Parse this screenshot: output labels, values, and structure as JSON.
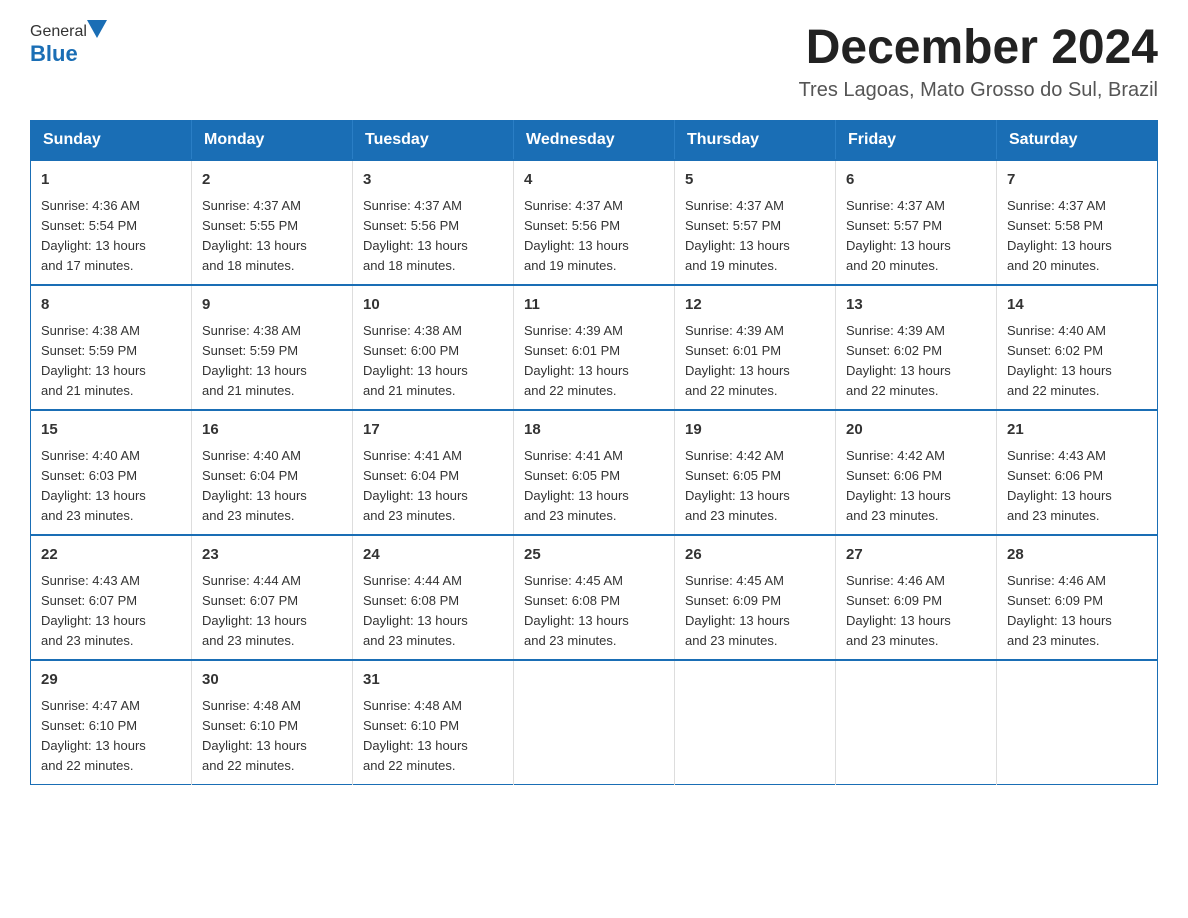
{
  "header": {
    "logo_general": "General",
    "logo_blue": "Blue",
    "main_title": "December 2024",
    "subtitle": "Tres Lagoas, Mato Grosso do Sul, Brazil"
  },
  "weekdays": [
    "Sunday",
    "Monday",
    "Tuesday",
    "Wednesday",
    "Thursday",
    "Friday",
    "Saturday"
  ],
  "weeks": [
    [
      {
        "day": "1",
        "sunrise": "4:36 AM",
        "sunset": "5:54 PM",
        "daylight": "13 hours and 17 minutes."
      },
      {
        "day": "2",
        "sunrise": "4:37 AM",
        "sunset": "5:55 PM",
        "daylight": "13 hours and 18 minutes."
      },
      {
        "day": "3",
        "sunrise": "4:37 AM",
        "sunset": "5:56 PM",
        "daylight": "13 hours and 18 minutes."
      },
      {
        "day": "4",
        "sunrise": "4:37 AM",
        "sunset": "5:56 PM",
        "daylight": "13 hours and 19 minutes."
      },
      {
        "day": "5",
        "sunrise": "4:37 AM",
        "sunset": "5:57 PM",
        "daylight": "13 hours and 19 minutes."
      },
      {
        "day": "6",
        "sunrise": "4:37 AM",
        "sunset": "5:57 PM",
        "daylight": "13 hours and 20 minutes."
      },
      {
        "day": "7",
        "sunrise": "4:37 AM",
        "sunset": "5:58 PM",
        "daylight": "13 hours and 20 minutes."
      }
    ],
    [
      {
        "day": "8",
        "sunrise": "4:38 AM",
        "sunset": "5:59 PM",
        "daylight": "13 hours and 21 minutes."
      },
      {
        "day": "9",
        "sunrise": "4:38 AM",
        "sunset": "5:59 PM",
        "daylight": "13 hours and 21 minutes."
      },
      {
        "day": "10",
        "sunrise": "4:38 AM",
        "sunset": "6:00 PM",
        "daylight": "13 hours and 21 minutes."
      },
      {
        "day": "11",
        "sunrise": "4:39 AM",
        "sunset": "6:01 PM",
        "daylight": "13 hours and 22 minutes."
      },
      {
        "day": "12",
        "sunrise": "4:39 AM",
        "sunset": "6:01 PM",
        "daylight": "13 hours and 22 minutes."
      },
      {
        "day": "13",
        "sunrise": "4:39 AM",
        "sunset": "6:02 PM",
        "daylight": "13 hours and 22 minutes."
      },
      {
        "day": "14",
        "sunrise": "4:40 AM",
        "sunset": "6:02 PM",
        "daylight": "13 hours and 22 minutes."
      }
    ],
    [
      {
        "day": "15",
        "sunrise": "4:40 AM",
        "sunset": "6:03 PM",
        "daylight": "13 hours and 23 minutes."
      },
      {
        "day": "16",
        "sunrise": "4:40 AM",
        "sunset": "6:04 PM",
        "daylight": "13 hours and 23 minutes."
      },
      {
        "day": "17",
        "sunrise": "4:41 AM",
        "sunset": "6:04 PM",
        "daylight": "13 hours and 23 minutes."
      },
      {
        "day": "18",
        "sunrise": "4:41 AM",
        "sunset": "6:05 PM",
        "daylight": "13 hours and 23 minutes."
      },
      {
        "day": "19",
        "sunrise": "4:42 AM",
        "sunset": "6:05 PM",
        "daylight": "13 hours and 23 minutes."
      },
      {
        "day": "20",
        "sunrise": "4:42 AM",
        "sunset": "6:06 PM",
        "daylight": "13 hours and 23 minutes."
      },
      {
        "day": "21",
        "sunrise": "4:43 AM",
        "sunset": "6:06 PM",
        "daylight": "13 hours and 23 minutes."
      }
    ],
    [
      {
        "day": "22",
        "sunrise": "4:43 AM",
        "sunset": "6:07 PM",
        "daylight": "13 hours and 23 minutes."
      },
      {
        "day": "23",
        "sunrise": "4:44 AM",
        "sunset": "6:07 PM",
        "daylight": "13 hours and 23 minutes."
      },
      {
        "day": "24",
        "sunrise": "4:44 AM",
        "sunset": "6:08 PM",
        "daylight": "13 hours and 23 minutes."
      },
      {
        "day": "25",
        "sunrise": "4:45 AM",
        "sunset": "6:08 PM",
        "daylight": "13 hours and 23 minutes."
      },
      {
        "day": "26",
        "sunrise": "4:45 AM",
        "sunset": "6:09 PM",
        "daylight": "13 hours and 23 minutes."
      },
      {
        "day": "27",
        "sunrise": "4:46 AM",
        "sunset": "6:09 PM",
        "daylight": "13 hours and 23 minutes."
      },
      {
        "day": "28",
        "sunrise": "4:46 AM",
        "sunset": "6:09 PM",
        "daylight": "13 hours and 23 minutes."
      }
    ],
    [
      {
        "day": "29",
        "sunrise": "4:47 AM",
        "sunset": "6:10 PM",
        "daylight": "13 hours and 22 minutes."
      },
      {
        "day": "30",
        "sunrise": "4:48 AM",
        "sunset": "6:10 PM",
        "daylight": "13 hours and 22 minutes."
      },
      {
        "day": "31",
        "sunrise": "4:48 AM",
        "sunset": "6:10 PM",
        "daylight": "13 hours and 22 minutes."
      },
      null,
      null,
      null,
      null
    ]
  ],
  "labels": {
    "sunrise": "Sunrise:",
    "sunset": "Sunset:",
    "daylight": "Daylight:"
  }
}
